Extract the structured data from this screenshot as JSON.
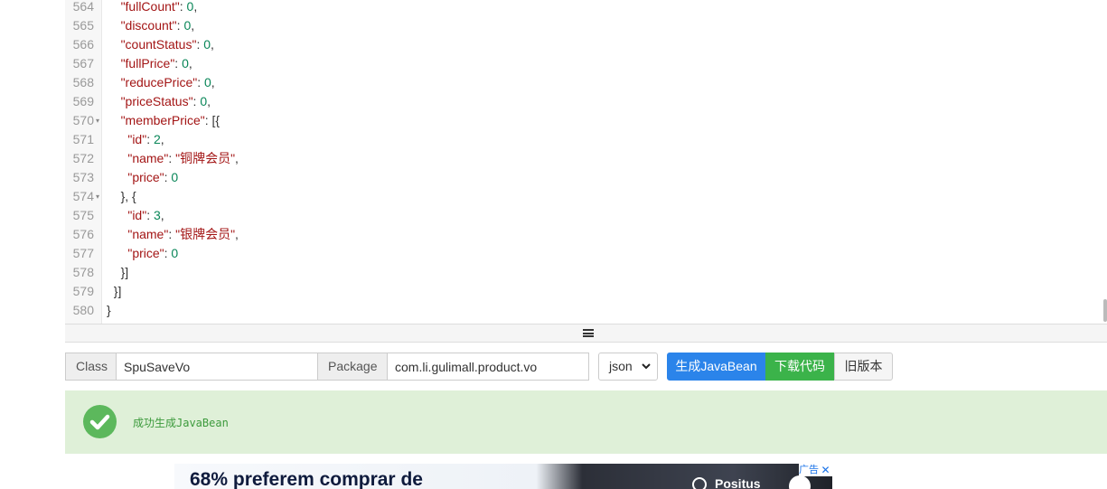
{
  "editor": {
    "lines": [
      {
        "num": "564",
        "fold": false,
        "indent": "    ",
        "key": "\"fullCount\"",
        "sep": ": ",
        "value": "0",
        "vtype": "n",
        "tail": ","
      },
      {
        "num": "565",
        "fold": false,
        "indent": "    ",
        "key": "\"discount\"",
        "sep": ": ",
        "value": "0",
        "vtype": "n",
        "tail": ","
      },
      {
        "num": "566",
        "fold": false,
        "indent": "    ",
        "key": "\"countStatus\"",
        "sep": ": ",
        "value": "0",
        "vtype": "n",
        "tail": ","
      },
      {
        "num": "567",
        "fold": false,
        "indent": "    ",
        "key": "\"fullPrice\"",
        "sep": ": ",
        "value": "0",
        "vtype": "n",
        "tail": ","
      },
      {
        "num": "568",
        "fold": false,
        "indent": "    ",
        "key": "\"reducePrice\"",
        "sep": ": ",
        "value": "0",
        "vtype": "n",
        "tail": ","
      },
      {
        "num": "569",
        "fold": false,
        "indent": "    ",
        "key": "\"priceStatus\"",
        "sep": ": ",
        "value": "0",
        "vtype": "n",
        "tail": ","
      },
      {
        "num": "570",
        "fold": true,
        "indent": "    ",
        "key": "\"memberPrice\"",
        "sep": ": ",
        "value": "",
        "vtype": "p",
        "tail": "[{"
      },
      {
        "num": "571",
        "fold": false,
        "indent": "      ",
        "key": "\"id\"",
        "sep": ": ",
        "value": "2",
        "vtype": "n",
        "tail": ","
      },
      {
        "num": "572",
        "fold": false,
        "indent": "      ",
        "key": "\"name\"",
        "sep": ": ",
        "value": "\"铜牌会员\"",
        "vtype": "s",
        "tail": ","
      },
      {
        "num": "573",
        "fold": false,
        "indent": "      ",
        "key": "\"price\"",
        "sep": ": ",
        "value": "0",
        "vtype": "n",
        "tail": ""
      },
      {
        "num": "574",
        "fold": true,
        "indent": "    ",
        "key": "",
        "sep": "",
        "value": "",
        "vtype": "p",
        "tail": "}, {"
      },
      {
        "num": "575",
        "fold": false,
        "indent": "      ",
        "key": "\"id\"",
        "sep": ": ",
        "value": "3",
        "vtype": "n",
        "tail": ","
      },
      {
        "num": "576",
        "fold": false,
        "indent": "      ",
        "key": "\"name\"",
        "sep": ": ",
        "value": "\"银牌会员\"",
        "vtype": "s",
        "tail": ","
      },
      {
        "num": "577",
        "fold": false,
        "indent": "      ",
        "key": "\"price\"",
        "sep": ": ",
        "value": "0",
        "vtype": "n",
        "tail": ""
      },
      {
        "num": "578",
        "fold": false,
        "indent": "    ",
        "key": "",
        "sep": "",
        "value": "",
        "vtype": "p",
        "tail": "}]"
      },
      {
        "num": "579",
        "fold": false,
        "indent": "  ",
        "key": "",
        "sep": "",
        "value": "",
        "vtype": "p",
        "tail": "}]"
      },
      {
        "num": "580",
        "fold": false,
        "indent": "",
        "key": "",
        "sep": "",
        "value": "",
        "vtype": "p",
        "tail": "}"
      }
    ]
  },
  "form": {
    "class_label": "Class",
    "class_value": "SpuSaveVo",
    "package_label": "Package",
    "package_value": "com.li.gulimall.product.vo",
    "format_selected": "json",
    "generate_button": "生成JavaBean",
    "download_button": "下载代码",
    "old_version_button": "旧版本"
  },
  "alert": {
    "message": "成功生成JavaBean"
  },
  "ad": {
    "headline": "68% preferem comprar de",
    "brand": "Positus",
    "ad_label": "广告",
    "close_glyph": "✕"
  },
  "colors": {
    "primary": "#2b84ea",
    "success": "#3bb34a",
    "alert_bg": "#dff0d8",
    "check": "#5cb85c"
  }
}
